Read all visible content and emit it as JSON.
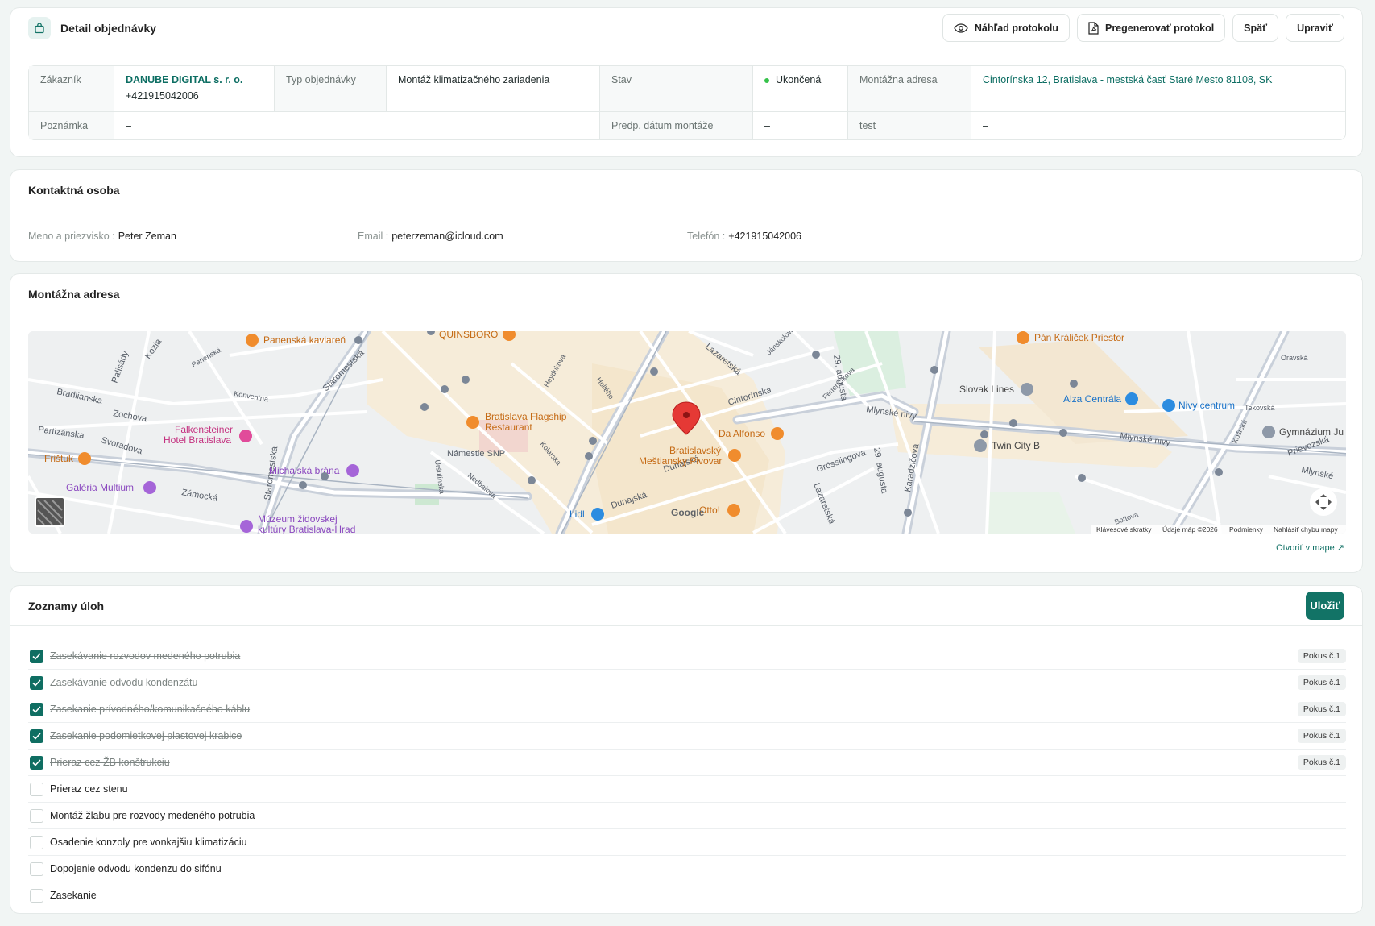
{
  "header": {
    "title": "Detail objednávky",
    "buttons": {
      "preview": "Náhľad protokolu",
      "regenerate": "Pregenerovať protokol",
      "back": "Späť",
      "edit": "Upraviť"
    }
  },
  "order_info": {
    "customer_label": "Zákazník",
    "customer_name": "DANUBE DIGITAL s. r. o.",
    "customer_phone": "+421915042006",
    "order_type_label": "Typ objednávky",
    "order_type": "Montáž klimatizačného zariadenia",
    "status_label": "Stav",
    "status": "Ukončená",
    "status_color": "#35c24a",
    "address_label": "Montážna adresa",
    "address": "Cintorínska 12, Bratislava - mestská časť Staré Mesto 81108, SK",
    "note_label": "Poznámka",
    "note": "–",
    "install_date_label": "Predp. dátum montáže",
    "install_date": "–",
    "extra_label": "test",
    "extra_value": "–"
  },
  "contact": {
    "title": "Kontaktná osoba",
    "name_label": "Meno a priezvisko :",
    "name": "Peter Zeman",
    "email_label": "Email :",
    "email": "peterzeman@icloud.com",
    "phone_label": "Telefón :",
    "phone": "+421915042006"
  },
  "map_section": {
    "title": "Montážna adresa",
    "open_link": "Otvoriť v mape ↗",
    "attribution": {
      "shortcuts": "Klávesové skratky",
      "data": "Údaje máp ©2026",
      "terms": "Podmienky",
      "report": "Nahlásiť chybu mapy"
    },
    "labels": {
      "panenska_kaviaren": "Panenská kaviareň",
      "quinsboro": "QUINSBORO",
      "pan_kralicek": "Pán Králiček Priestor",
      "slovak_lines": "Slovak Lines",
      "alza": "Alza Centrála",
      "nivy": "Nivy centrum",
      "gymnazium": "Gymnázium Ju",
      "flagship_1": "Bratislava Flagship",
      "flagship_2": "Restaurant",
      "falkensteiner_1": "Falkensteiner",
      "falkensteiner_2": "Hotel Bratislava",
      "fristuk": "Frištuk",
      "galeria": "Galéria Multium",
      "michalska": "Michalská brána",
      "muzeum_1": "Múzeum židovskej",
      "muzeum_2": "kultúry Bratislava-Hrad",
      "da_alfonso": "Da Alfonso",
      "mestiansky_1": "Bratislavský",
      "mestiansky_2": "Meštiansky Pivovar",
      "lidl": "Lidl",
      "otto": "Otto!",
      "twin_city": "Twin City B",
      "namestie_snp": "Námestie SNP",
      "mlynske_nivy": "Mlynské nivy",
      "mlynske_nivy_2": "Mlynské nivy",
      "mlynske_nivy_3": "Mlynské",
      "cintorinska": "Cintorínska",
      "lazaretska": "Lazaretská",
      "lazaretska_2": "Lazaretská",
      "dunajska": "Dunajská",
      "dunajska_2": "Dunajská",
      "grosslingova": "Grösslingova",
      "augusta_1": "29. augusta",
      "augusta_2": "29. augusta",
      "karadzicova": "Karadžičova",
      "staromestska_1": "Staromestská",
      "staromestska_2": "Staromestská",
      "zochova": "Zochova",
      "partizanska": "Partizánska",
      "palisady": "Palisády",
      "kozia": "Kozia",
      "bradlianska": "Bradlianska",
      "svoradova": "Svoradova",
      "zamocka": "Zámocká",
      "panenska": "Panenská",
      "konventna": "Konventná",
      "heydukova": "Heydukova",
      "hollého": "Hollého",
      "kolarska": "Kolárska",
      "nedbalova": "Nedbalova",
      "urstinska": "Uršulínska",
      "prievozska": "Prievozská",
      "kosicka": "Košická",
      "ferienckova": "Ferienčíkova",
      "tekovska": "Tekovská",
      "oravska": "Oravská",
      "bottova": "Bottova",
      "jankolova": "Jánskolova",
      "google": "Google"
    }
  },
  "tasks": {
    "title": "Zoznamy úloh",
    "save_label": "Uložiť",
    "items": [
      {
        "label": "Zasekávanie rozvodov medeného potrubia",
        "done": true,
        "badge": "Pokus č.1"
      },
      {
        "label": "Zasekávanie odvodu kondenzátu",
        "done": true,
        "badge": "Pokus č.1"
      },
      {
        "label": "Zasekanie prívodného/komunikačného káblu",
        "done": true,
        "badge": "Pokus č.1"
      },
      {
        "label": "Zasekanie podomietkovej plastovej krabice",
        "done": true,
        "badge": "Pokus č.1"
      },
      {
        "label": "Prieraz cez ŽB konštrukciu",
        "done": true,
        "badge": "Pokus č.1"
      },
      {
        "label": "Prieraz cez stenu",
        "done": false,
        "badge": ""
      },
      {
        "label": "Montáž žlabu pre rozvody medeného potrubia",
        "done": false,
        "badge": ""
      },
      {
        "label": "Osadenie konzoly pre vonkajšiu klimatizáciu",
        "done": false,
        "badge": ""
      },
      {
        "label": "Dopojenie odvodu kondenzu do sifónu",
        "done": false,
        "badge": ""
      },
      {
        "label": "Zasekanie",
        "done": false,
        "badge": ""
      }
    ]
  },
  "colors": {
    "accent": "#127366",
    "link": "#0d6e63",
    "checkbox_on": "#0f6e62"
  }
}
